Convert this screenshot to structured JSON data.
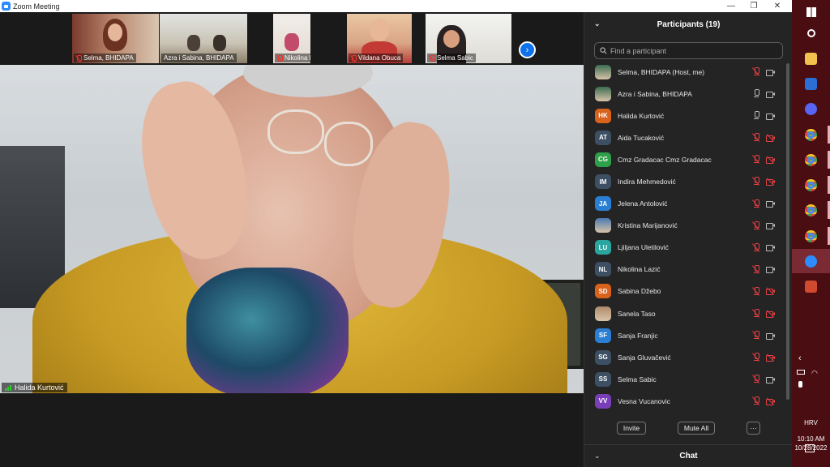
{
  "window": {
    "title": "Zoom Meeting"
  },
  "colors": {
    "accent": "#0e72ed",
    "muted_red": "#e34444",
    "panel_bg": "#242424",
    "taskbar": "#4a0d12"
  },
  "gallery": {
    "thumbnails": [
      {
        "name": "Selma, BHIDAPA",
        "muted": true
      },
      {
        "name": "Azra i Sabina, BHIDAPA",
        "muted": false
      },
      {
        "name": "Nikolina Lazić",
        "muted": true
      },
      {
        "name": "Vildana Obuca",
        "muted": true
      },
      {
        "name": "Selma Sabic",
        "muted": true
      }
    ]
  },
  "active_speaker": {
    "name": "Halida Kurtović"
  },
  "participants_panel": {
    "title": "Participants (19)",
    "search_placeholder": "Find a participant",
    "participants": [
      {
        "initials": "",
        "avatar": "photo",
        "avatar_color": "#3a6b4f",
        "name": "Selma, BHIDAPA (Host, me)",
        "mic": "muted",
        "video": "on"
      },
      {
        "initials": "",
        "avatar": "photo",
        "avatar_color": "#3a6b4f",
        "name": "Azra i Sabina, BHIDAPA",
        "mic": "on",
        "video": "on"
      },
      {
        "initials": "HK",
        "avatar": "initials",
        "avatar_color": "#d9621c",
        "name": "Halida Kurtović",
        "mic": "on",
        "video": "on"
      },
      {
        "initials": "AT",
        "avatar": "initials",
        "avatar_color": "#3c4f63",
        "name": "Aida Tucaković",
        "mic": "muted",
        "video": "off"
      },
      {
        "initials": "CG",
        "avatar": "initials",
        "avatar_color": "#2fa04a",
        "name": "Cmz Gradacac Cmz Gradacac",
        "mic": "muted",
        "video": "off"
      },
      {
        "initials": "IM",
        "avatar": "initials",
        "avatar_color": "#3c4f63",
        "name": "Indira Mehmedović",
        "mic": "muted",
        "video": "off"
      },
      {
        "initials": "JA",
        "avatar": "initials",
        "avatar_color": "#2a7fd4",
        "name": "Jelena Antolović",
        "mic": "muted",
        "video": "on"
      },
      {
        "initials": "",
        "avatar": "photo",
        "avatar_color": "#4a78b0",
        "name": "Kristina Marijanović",
        "mic": "muted",
        "video": "on"
      },
      {
        "initials": "LU",
        "avatar": "initials",
        "avatar_color": "#2aa5a0",
        "name": "Ljiljana Uletilović",
        "mic": "muted",
        "video": "on"
      },
      {
        "initials": "NL",
        "avatar": "initials",
        "avatar_color": "#3c4f63",
        "name": "Nikolina Lazić",
        "mic": "muted",
        "video": "on"
      },
      {
        "initials": "SD",
        "avatar": "initials",
        "avatar_color": "#d9621c",
        "name": "Sabina Džebo",
        "mic": "muted",
        "video": "off"
      },
      {
        "initials": "",
        "avatar": "photo",
        "avatar_color": "#b08a6a",
        "name": "Sanela Taso",
        "mic": "muted",
        "video": "off"
      },
      {
        "initials": "SF",
        "avatar": "initials",
        "avatar_color": "#2a7fd4",
        "name": "Sanja Franjic",
        "mic": "muted",
        "video": "on"
      },
      {
        "initials": "SG",
        "avatar": "initials",
        "avatar_color": "#3c4f63",
        "name": "Sanja Gluvačević",
        "mic": "muted",
        "video": "off"
      },
      {
        "initials": "SS",
        "avatar": "initials",
        "avatar_color": "#3c4f63",
        "name": "Selma Sabic",
        "mic": "muted",
        "video": "on"
      },
      {
        "initials": "VV",
        "avatar": "initials",
        "avatar_color": "#7a3fb8",
        "name": "Vesna Vucanovic",
        "mic": "muted",
        "video": "off"
      }
    ],
    "invite_label": "Invite",
    "mute_all_label": "Mute All",
    "more_label": "···"
  },
  "chat": {
    "title": "Chat"
  },
  "taskbar": {
    "apps": [
      {
        "icon": "windows-start-icon",
        "color": "#ffffff"
      },
      {
        "icon": "search-icon",
        "color": "#ffffff"
      },
      {
        "icon": "file-explorer-icon",
        "color": "#f2c14e"
      },
      {
        "icon": "word-icon",
        "color": "#2b6fd6"
      },
      {
        "icon": "discord-icon",
        "color": "#5865f2"
      },
      {
        "icon": "chrome-icon",
        "color": "#e9443a"
      },
      {
        "icon": "chrome-icon",
        "color": "#e9443a"
      },
      {
        "icon": "chrome-icon",
        "color": "#e9443a"
      },
      {
        "icon": "chrome-icon",
        "color": "#e9443a"
      },
      {
        "icon": "chrome-icon",
        "color": "#e9443a"
      },
      {
        "icon": "zoom-icon",
        "color": "#2d8cff"
      },
      {
        "icon": "powerpoint-icon",
        "color": "#d04a2f"
      }
    ],
    "language": "HRV",
    "time": "10:10 AM",
    "date": "10/28/2022"
  }
}
